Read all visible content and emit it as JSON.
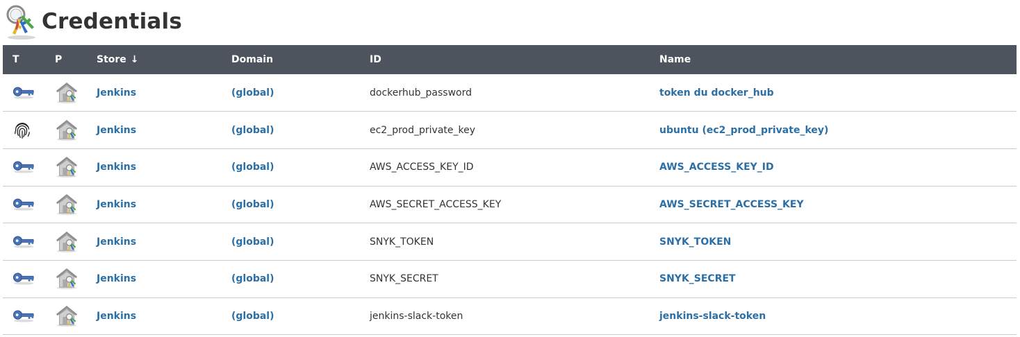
{
  "page": {
    "title": "Credentials",
    "logo_icon": "credentials-keys-icon"
  },
  "table": {
    "headers": {
      "type": "T",
      "provider": "P",
      "store": "Store",
      "store_sort_arrow": "↓",
      "domain": "Domain",
      "id": "ID",
      "name": "Name"
    },
    "rows": [
      {
        "type_icon": "key-icon",
        "provider_icon": "jenkins-store-icon",
        "store": "Jenkins",
        "domain": "(global)",
        "id": "dockerhub_password",
        "name": "token du docker_hub"
      },
      {
        "type_icon": "fingerprint-icon",
        "provider_icon": "jenkins-store-icon",
        "store": "Jenkins",
        "domain": "(global)",
        "id": "ec2_prod_private_key",
        "name": "ubuntu (ec2_prod_private_key)"
      },
      {
        "type_icon": "key-icon",
        "provider_icon": "jenkins-store-icon",
        "store": "Jenkins",
        "domain": "(global)",
        "id": "AWS_ACCESS_KEY_ID",
        "name": "AWS_ACCESS_KEY_ID"
      },
      {
        "type_icon": "key-icon",
        "provider_icon": "jenkins-store-icon",
        "store": "Jenkins",
        "domain": "(global)",
        "id": "AWS_SECRET_ACCESS_KEY",
        "name": "AWS_SECRET_ACCESS_KEY"
      },
      {
        "type_icon": "key-icon",
        "provider_icon": "jenkins-store-icon",
        "store": "Jenkins",
        "domain": "(global)",
        "id": "SNYK_TOKEN",
        "name": "SNYK_TOKEN"
      },
      {
        "type_icon": "key-icon",
        "provider_icon": "jenkins-store-icon",
        "store": "Jenkins",
        "domain": "(global)",
        "id": "SNYK_SECRET",
        "name": "SNYK_SECRET"
      },
      {
        "type_icon": "key-icon",
        "provider_icon": "jenkins-store-icon",
        "store": "Jenkins",
        "domain": "(global)",
        "id": "jenkins-slack-token",
        "name": "jenkins-slack-token"
      }
    ]
  },
  "colors": {
    "header_bg": "#4d545d",
    "link": "#2c6fa6",
    "row_border": "#c8cbd0",
    "key_blue": "#4a74b8"
  }
}
